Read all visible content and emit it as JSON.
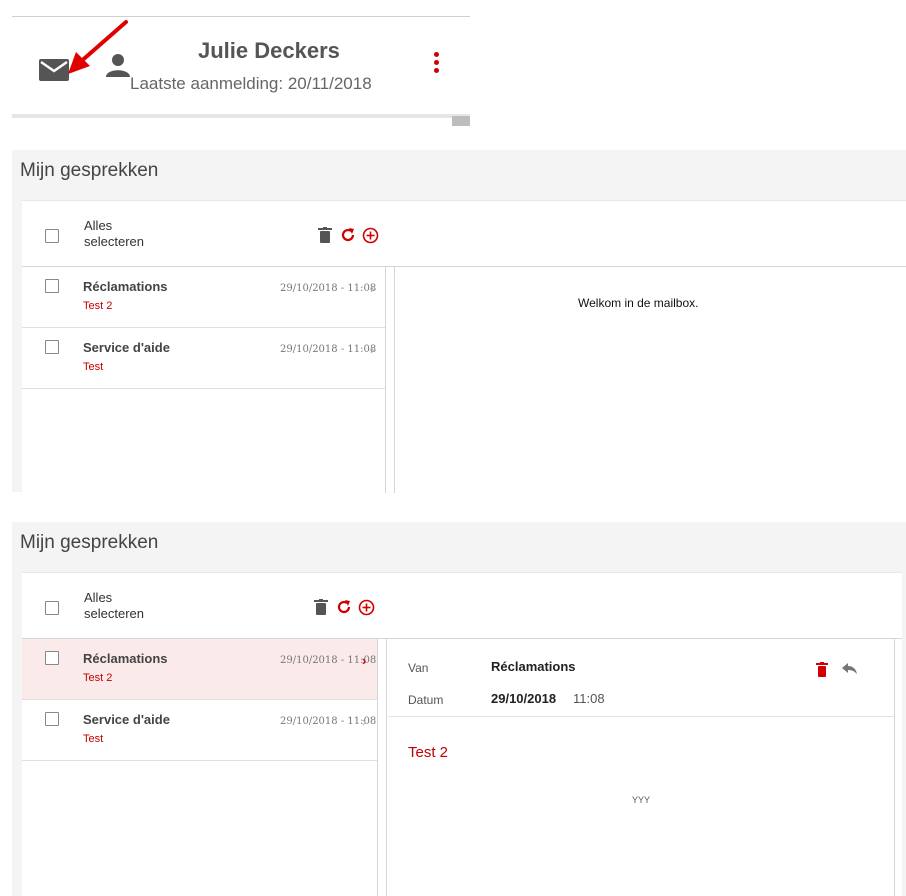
{
  "header": {
    "user_name": "Julie Deckers",
    "last_login": "Laatste aanmelding: 20/11/2018"
  },
  "mailbox": {
    "title": "Mijn gesprekken",
    "select_all_line1": "Alles",
    "select_all_line2": "selecteren",
    "welcome": "Welkom in de mailbox.",
    "conversations": [
      {
        "title": "Réclamations",
        "subtitle": "Test 2",
        "date": "29/10/2018 - 11:08"
      },
      {
        "title": "Service d'aide",
        "subtitle": "Test",
        "date": "29/10/2018 - 11:08"
      }
    ]
  },
  "detail": {
    "from_label": "Van",
    "from_value": "Réclamations",
    "date_label": "Datum",
    "date_value": "29/10/2018",
    "time_value": "11:08",
    "subject": "Test 2",
    "body": "YYY"
  },
  "colors": {
    "accent": "#d00000",
    "selected_row": "#fbeaea",
    "panel_bg": "#f4f4f4"
  },
  "icons": [
    "mail-icon",
    "user-icon",
    "more-vertical-icon",
    "trash-icon",
    "refresh-icon",
    "add-circle-icon",
    "chevron-right-icon",
    "reply-icon"
  ]
}
